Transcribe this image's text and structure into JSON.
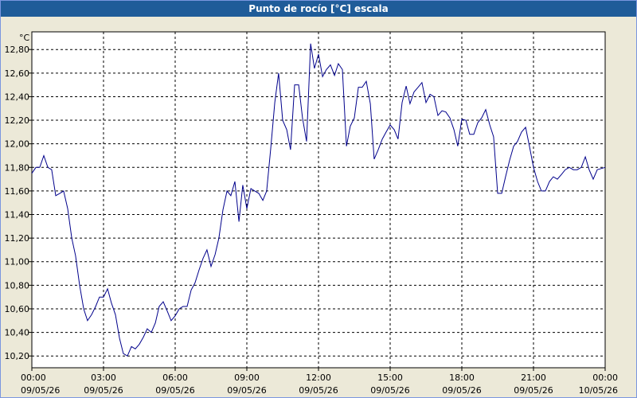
{
  "window": {
    "title": "Punto de rocío [°C] escala"
  },
  "chart_data": {
    "type": "line",
    "title": "Punto de rocío [°C] escala",
    "ylabel": "°C",
    "ylim": [
      10.1,
      12.95
    ],
    "xlim": [
      0,
      24
    ],
    "grid": true,
    "colors": {
      "line": "#00008B",
      "grid": "#000000",
      "plot_bg": "#FFFFFF",
      "title_bg": "#1F5C99"
    },
    "y_ticks": [
      "12,80",
      "12,60",
      "12,40",
      "12,20",
      "12,00",
      "11,80",
      "11,60",
      "11,40",
      "11,20",
      "11,00",
      "10,80",
      "10,60",
      "10,40",
      "10,20"
    ],
    "x_ticks": [
      {
        "time": "00:00",
        "date": "09/05/26"
      },
      {
        "time": "03:00",
        "date": "09/05/26"
      },
      {
        "time": "06:00",
        "date": "09/05/26"
      },
      {
        "time": "09:00",
        "date": "09/05/26"
      },
      {
        "time": "12:00",
        "date": "09/05/26"
      },
      {
        "time": "15:00",
        "date": "09/05/26"
      },
      {
        "time": "18:00",
        "date": "09/05/26"
      },
      {
        "time": "21:00",
        "date": "09/05/26"
      },
      {
        "time": "00:00",
        "date": "10/05/26"
      }
    ],
    "series": [
      {
        "x": [
          0,
          0.17,
          0.33,
          0.5,
          0.67,
          0.83,
          1.0,
          1.17,
          1.33,
          1.5,
          1.67,
          1.83,
          2.0,
          2.17,
          2.33,
          2.5,
          2.67,
          2.83,
          3.0,
          3.17,
          3.33,
          3.5,
          3.67,
          3.83,
          4.0,
          4.17,
          4.33,
          4.5,
          4.67,
          4.83,
          5.0,
          5.17,
          5.33,
          5.5,
          5.67,
          5.83,
          6.0,
          6.17,
          6.33,
          6.5,
          6.67,
          6.83,
          7.0,
          7.17,
          7.33,
          7.5,
          7.67,
          7.83,
          8.0,
          8.17,
          8.33,
          8.5,
          8.67,
          8.83,
          9.0,
          9.17,
          9.33,
          9.5,
          9.67,
          9.83,
          10.0,
          10.17,
          10.33,
          10.5,
          10.67,
          10.83,
          11.0,
          11.17,
          11.33,
          11.5,
          11.67,
          11.83,
          12.0,
          12.17,
          12.33,
          12.5,
          12.67,
          12.83,
          13.0,
          13.17,
          13.33,
          13.5,
          13.67,
          13.83,
          14.0,
          14.17,
          14.33,
          14.5,
          14.67,
          14.83,
          15.0,
          15.17,
          15.33,
          15.5,
          15.67,
          15.83,
          16.0,
          16.17,
          16.33,
          16.5,
          16.67,
          16.83,
          17.0,
          17.17,
          17.33,
          17.5,
          17.67,
          17.83,
          18.0,
          18.17,
          18.33,
          18.5,
          18.67,
          18.83,
          19.0,
          19.17,
          19.33,
          19.5,
          19.67,
          19.83,
          20.0,
          20.17,
          20.33,
          20.5,
          20.67,
          20.83,
          21.0,
          21.17,
          21.33,
          21.5,
          21.67,
          21.83,
          22.0,
          22.17,
          22.33,
          22.5,
          22.67,
          22.83,
          23.0,
          23.17,
          23.33,
          23.5,
          23.67,
          23.83,
          24.0
        ],
        "y": [
          11.75,
          11.8,
          11.8,
          11.9,
          11.8,
          11.78,
          11.56,
          11.58,
          11.6,
          11.45,
          11.2,
          11.05,
          10.8,
          10.6,
          10.5,
          10.55,
          10.62,
          10.7,
          10.7,
          10.77,
          10.65,
          10.55,
          10.35,
          10.22,
          10.2,
          10.28,
          10.26,
          10.3,
          10.36,
          10.43,
          10.4,
          10.48,
          10.62,
          10.66,
          10.58,
          10.5,
          10.54,
          10.6,
          10.62,
          10.62,
          10.76,
          10.82,
          10.93,
          11.03,
          11.1,
          10.96,
          11.06,
          11.2,
          11.44,
          11.6,
          11.56,
          11.68,
          11.34,
          11.65,
          11.45,
          11.62,
          11.6,
          11.58,
          11.52,
          11.6,
          11.96,
          12.35,
          12.6,
          12.2,
          12.12,
          11.95,
          12.5,
          12.5,
          12.22,
          12.02,
          12.85,
          12.64,
          12.76,
          12.57,
          12.63,
          12.67,
          12.58,
          12.68,
          12.63,
          11.98,
          12.15,
          12.22,
          12.48,
          12.48,
          12.53,
          12.34,
          11.87,
          11.95,
          12.04,
          12.1,
          12.16,
          12.12,
          12.04,
          12.35,
          12.49,
          12.34,
          12.44,
          12.48,
          12.52,
          12.35,
          12.42,
          12.4,
          12.24,
          12.28,
          12.27,
          12.22,
          12.12,
          11.98,
          12.21,
          12.2,
          12.08,
          12.08,
          12.18,
          12.22,
          12.29,
          12.16,
          12.06,
          11.58,
          11.58,
          11.72,
          11.86,
          11.98,
          12.02,
          12.1,
          12.14,
          11.98,
          11.8,
          11.68,
          11.6,
          11.6,
          11.68,
          11.72,
          11.7,
          11.74,
          11.78,
          11.8,
          11.78,
          11.78,
          11.8,
          11.89,
          11.78,
          11.7,
          11.78,
          11.79,
          11.8
        ]
      }
    ]
  }
}
